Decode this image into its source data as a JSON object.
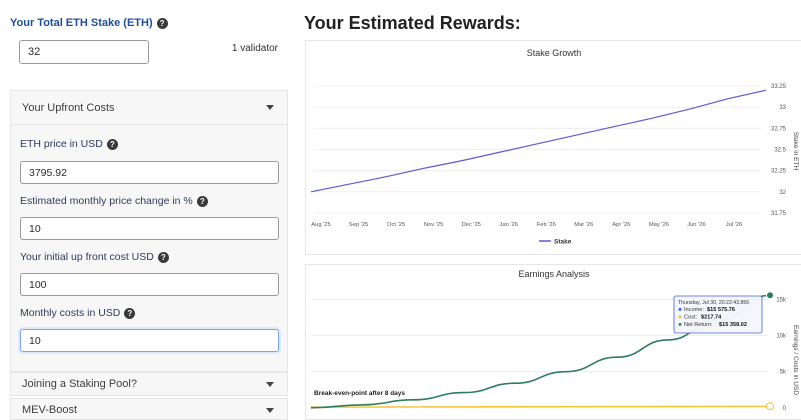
{
  "stake": {
    "label": "Your Total ETH Stake (ETH)",
    "value": "32",
    "validator_text": "1 validator"
  },
  "upfront": {
    "title": "Your Upfront Costs",
    "eth_price_label": "ETH price in USD",
    "eth_price_value": "3795.92",
    "monthly_change_label": "Estimated monthly price change in %",
    "monthly_change_value": "10",
    "initial_cost_label": "Your initial up front cost USD",
    "initial_cost_value": "100",
    "monthly_costs_label": "Monthly costs in USD",
    "monthly_costs_value": "10"
  },
  "sections": {
    "joining_pool": "Joining a Staking Pool?",
    "mev_boost": "MEV-Boost"
  },
  "help_glyph": "?",
  "rewards_title": "Your Estimated Rewards:",
  "colors": {
    "stake_line": "#5b5bd6",
    "income_line": "#2e7d5b",
    "cost_line": "#f2c232",
    "accent_blue": "#1f4e9c"
  },
  "growth_chart": {
    "chart_data": {
      "type": "line",
      "title": "Stake Growth",
      "ylabel": "Stake in ETH",
      "xlabel": "",
      "categories": [
        "Aug '25",
        "Sep '25",
        "Oct '25",
        "Nov '25",
        "Dec '25",
        "Jan '26",
        "Feb '26",
        "Mar '26",
        "Apr '26",
        "May '26",
        "Jun '26",
        "Jul '26"
      ],
      "y_ticks": [
        "31.75",
        "32",
        "32.25",
        "32.5",
        "32.75",
        "33",
        "33.25"
      ],
      "ylim": [
        31.75,
        33.25
      ],
      "series": [
        {
          "name": "Stake",
          "values": [
            32.0,
            32.09,
            32.18,
            32.28,
            32.37,
            32.47,
            32.57,
            32.67,
            32.77,
            32.87,
            32.98,
            33.1,
            33.2
          ]
        }
      ],
      "legend": "bottom-center",
      "grid": true
    }
  },
  "earnings_chart": {
    "chart_data": {
      "type": "line",
      "title": "Earnings Analysis",
      "ylabel": "Earnings / Costs in USD",
      "y_ticks": [
        "0",
        "5k",
        "10k",
        "15k"
      ],
      "ylim": [
        -1000,
        17000
      ],
      "series": [
        {
          "name": "Income",
          "values": [
            0,
            400,
            1100,
            2100,
            3400,
            5000,
            7000,
            9400,
            12200,
            15575.76
          ]
        },
        {
          "name": "Cost",
          "values": [
            100,
            112,
            125,
            137,
            149,
            162,
            174,
            187,
            199,
            217.74
          ]
        }
      ],
      "annotation": "Break-even-point after 8 days",
      "grid": true
    },
    "tooltip": {
      "date": "Thursday, Jul 30, 20:22:43.856",
      "rows": [
        {
          "label": "Income:",
          "value": "$15 575.76",
          "color": "#3a5fd6"
        },
        {
          "label": "Cost:",
          "value": "$217.74",
          "color": "#f2c232"
        },
        {
          "label": "Net Return:",
          "value": "$15 358.02",
          "color": "#2e8b57"
        }
      ]
    }
  }
}
